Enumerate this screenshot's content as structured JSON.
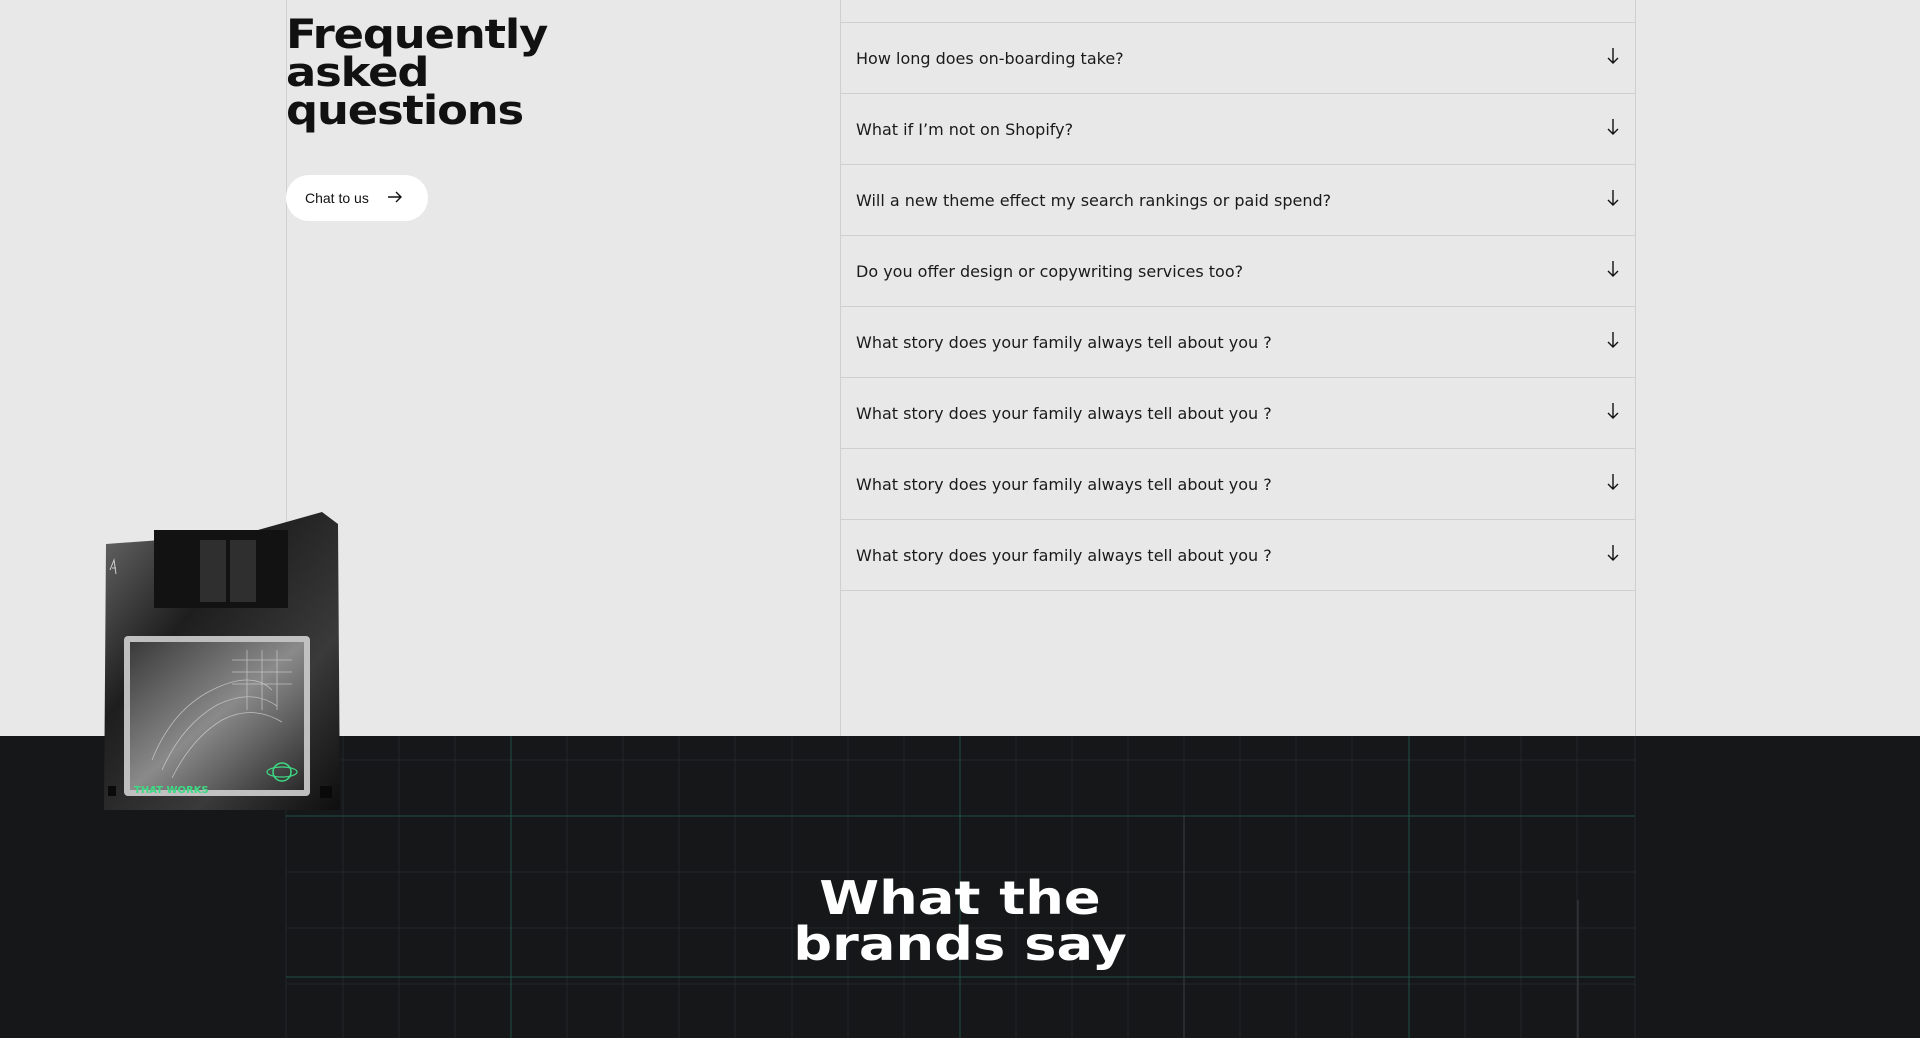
{
  "faq": {
    "title": "Frequently asked questions",
    "chat_label": "Chat to us",
    "items": [
      {
        "question": "How long does on-boarding take?"
      },
      {
        "question": "What if I’m not on Shopify?"
      },
      {
        "question": "Will a new theme effect my search rankings or paid spend?"
      },
      {
        "question": "Do you offer design or copywriting services too?"
      },
      {
        "question": "What story does your family always tell about you ?"
      },
      {
        "question": "What story does your family always tell about you ?"
      },
      {
        "question": "What story does your family always tell about you ?"
      },
      {
        "question": "What story does your family always tell about you ?"
      }
    ]
  },
  "floppy": {
    "label": "THAT WORKS",
    "accent": "#3ddc84"
  },
  "brands": {
    "title_line1": "What the",
    "title_line2": "brands say"
  },
  "colors": {
    "light_bg": "#e8e8e8",
    "dark_bg": "#151719",
    "grid_accent": "#2a6f5a"
  },
  "icons": {
    "chat_arrow": "arrow-right-icon",
    "faq_toggle": "arrow-down-icon"
  }
}
